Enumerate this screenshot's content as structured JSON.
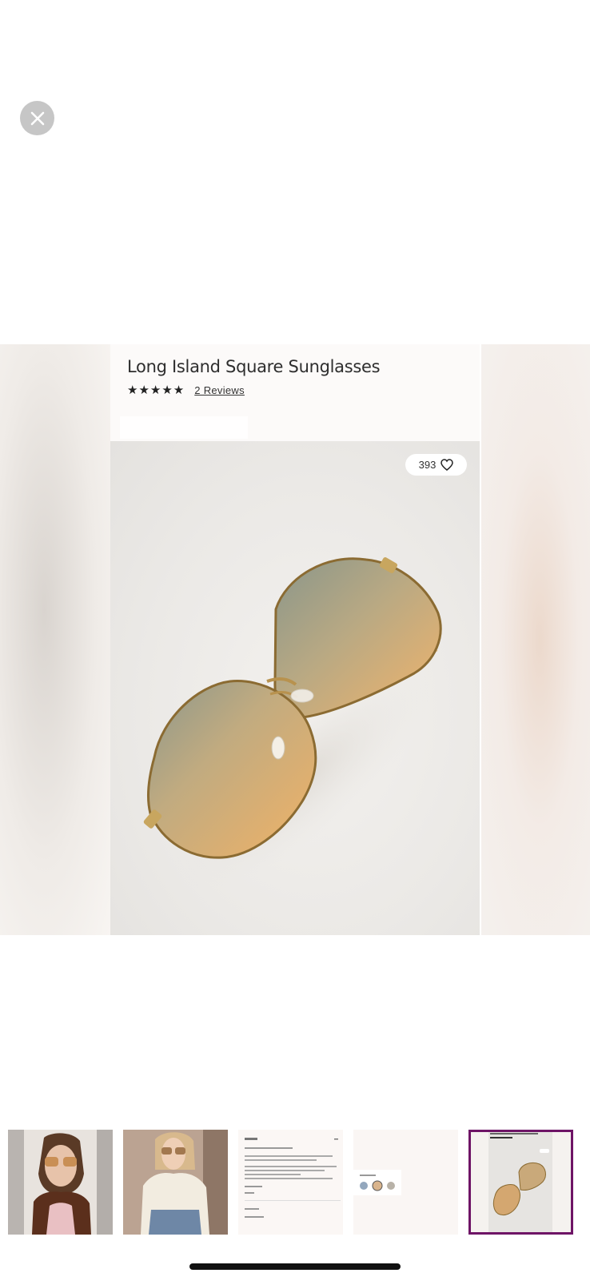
{
  "product": {
    "title": "Long Island Square Sunglasses",
    "stars": "★★★★★",
    "reviews_label": "2 Reviews",
    "likes": "393"
  },
  "icons": {
    "close": "close-icon",
    "heart": "heart-icon"
  },
  "thumbnails": [
    {
      "name": "thumbnail-model-brown-jacket",
      "selected": false
    },
    {
      "name": "thumbnail-model-white-blouse",
      "selected": false
    },
    {
      "name": "thumbnail-details-screenshot",
      "selected": false
    },
    {
      "name": "thumbnail-color-swatches",
      "selected": false
    },
    {
      "name": "thumbnail-product-sunglasses",
      "selected": true
    }
  ],
  "colors": {
    "selected_border": "#6e1466",
    "lens_top": "#8f9a89",
    "lens_bottom": "#f0b56d",
    "frame_gold": "#b8924e"
  }
}
